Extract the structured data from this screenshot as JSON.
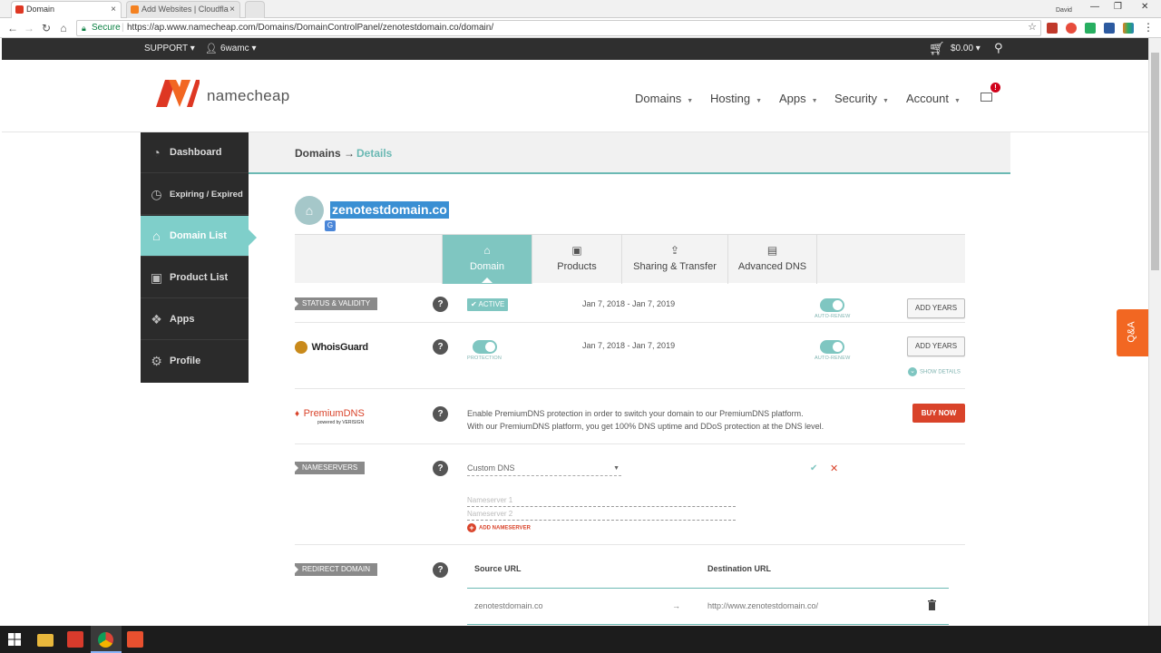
{
  "browser": {
    "tabs": [
      {
        "title": "Domain"
      },
      {
        "title": "Add Websites | Cloudfla"
      }
    ],
    "secure_label": "Secure",
    "url": "https://ap.www.namecheap.com/Domains/DomainControlPanel/zenotestdomain.co/domain/",
    "user_name": "David"
  },
  "topbar": {
    "support": "SUPPORT",
    "user": "6wamc",
    "cart_total": "$0.00"
  },
  "header": {
    "logo_text": "namecheap",
    "nav": [
      "Domains",
      "Hosting",
      "Apps",
      "Security",
      "Account"
    ],
    "mail_badge": "!"
  },
  "sidebar": {
    "items": [
      {
        "label": "Dashboard",
        "icon": "gauge-icon"
      },
      {
        "label": "Expiring / Expired",
        "icon": "clock-icon"
      },
      {
        "label": "Domain List",
        "icon": "home-icon"
      },
      {
        "label": "Product List",
        "icon": "box-icon"
      },
      {
        "label": "Apps",
        "icon": "apps-icon"
      },
      {
        "label": "Profile",
        "icon": "gear-icon"
      }
    ]
  },
  "breadcrumb": {
    "root": "Domains →",
    "current": "Details"
  },
  "domain": {
    "name": "zenotestdomain.co"
  },
  "tabs": [
    {
      "label": "Domain",
      "icon": "home-icon"
    },
    {
      "label": "Products",
      "icon": "box-icon"
    },
    {
      "label": "Sharing & Transfer",
      "icon": "share-icon"
    },
    {
      "label": "Advanced DNS",
      "icon": "server-icon"
    }
  ],
  "status": {
    "tag": "STATUS & VALIDITY",
    "badge": "ACTIVE",
    "dates": "Jan 7, 2018 - Jan 7, 2019",
    "toggle_label": "AUTO-RENEW",
    "toggle_on": true,
    "button": "ADD YEARS"
  },
  "whoisguard": {
    "logo": "WhoisGuard",
    "toggle_label": "PROTECTION",
    "toggle_on": true,
    "dates": "Jan 7, 2018 - Jan 7, 2019",
    "toggle2_label": "AUTO-RENEW",
    "button": "ADD YEARS",
    "show_details": "SHOW DETAILS"
  },
  "premiumdns": {
    "logo_text": "PremiumDNS",
    "logo_sub": "powered by VERISIGN",
    "desc_line1": "Enable PremiumDNS protection in order to switch your domain to our PremiumDNS platform.",
    "desc_line2": "With our PremiumDNS platform, you get 100% DNS uptime and DDoS protection at the DNS level.",
    "button": "BUY NOW"
  },
  "nameservers": {
    "tag": "NAMESERVERS",
    "selected": "Custom DNS",
    "ns1_placeholder": "Nameserver 1",
    "ns2_placeholder": "Nameserver 2",
    "add": "ADD NAMESERVER"
  },
  "redirect": {
    "tag": "REDIRECT DOMAIN",
    "col_source": "Source URL",
    "col_dest": "Destination URL",
    "source": "zenotestdomain.co",
    "arrow": "→",
    "dest": "http://www.zenotestdomain.co/"
  },
  "qa": "Q&A",
  "colors": {
    "accent": "#7fc6c1",
    "brand_orange": "#f26722",
    "danger": "#d9432a",
    "dark": "#2b2b2b"
  }
}
